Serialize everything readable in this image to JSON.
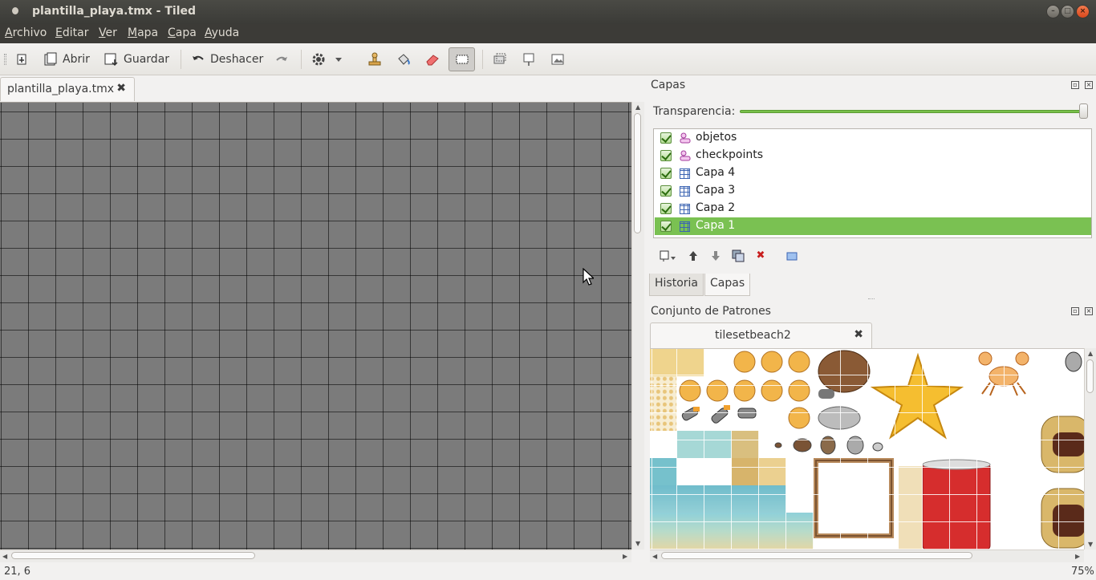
{
  "window": {
    "title": "plantilla_playa.tmx - Tiled"
  },
  "menu": [
    {
      "label": "Archivo",
      "u": "A",
      "rest": "rchivo"
    },
    {
      "label": "Editar",
      "u": "E",
      "rest": "ditar"
    },
    {
      "label": "Ver",
      "u": "V",
      "rest": "er"
    },
    {
      "label": "Mapa",
      "u": "M",
      "rest": "apa"
    },
    {
      "label": "Capa",
      "u": "C",
      "rest": "apa"
    },
    {
      "label": "Ayuda",
      "u": "A",
      "rest": "yuda"
    }
  ],
  "toolbar": {
    "open_label": "Abrir",
    "save_label": "Guardar",
    "undo_label": "Deshacer"
  },
  "document": {
    "tab_label": "plantilla_playa.tmx"
  },
  "layers_panel": {
    "title": "Capas",
    "opacity_label": "Transparencia:",
    "opacity_value": 1.0,
    "layers": [
      {
        "name": "objetos",
        "type": "object-layer",
        "visible": true,
        "selected": false
      },
      {
        "name": "checkpoints",
        "type": "object-layer",
        "visible": true,
        "selected": false
      },
      {
        "name": "Capa 4",
        "type": "tile-layer",
        "visible": true,
        "selected": false
      },
      {
        "name": "Capa 3",
        "type": "tile-layer",
        "visible": true,
        "selected": false
      },
      {
        "name": "Capa 2",
        "type": "tile-layer",
        "visible": true,
        "selected": false
      },
      {
        "name": "Capa 1",
        "type": "tile-layer",
        "visible": true,
        "selected": true
      }
    ],
    "tabs": [
      {
        "label": "Historia",
        "active": false
      },
      {
        "label": "Capas",
        "active": true
      }
    ]
  },
  "tileset_panel": {
    "title": "Conjunto de Patrones",
    "tab_label": "tilesetbeach2"
  },
  "status": {
    "coords": "21, 6",
    "zoom": "75%"
  },
  "colors": {
    "selection": "#7ac152",
    "titlebar": "#3c3b37",
    "map_bg": "#7b7b7b"
  }
}
